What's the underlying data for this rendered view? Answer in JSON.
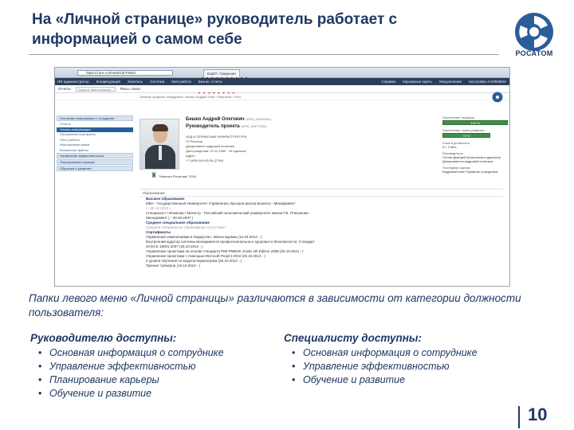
{
  "slide": {
    "title": "На «Личной странице» руководитель работает с информацией о самом себе",
    "logo_text": "РОСАТОМ",
    "page_number": "10",
    "caption": "Папки левого меню «Личной страницы» различаются в зависимости от категории должности пользователя:",
    "manager": {
      "heading": "Руководителю доступны:",
      "items": [
        "Основная информация о сотруднике",
        "Управление эффективностью",
        "Планирование карьеры",
        "Обучение и развитие"
      ]
    },
    "specialist": {
      "heading": "Специалисту доступны:",
      "items": [
        "Основная информация о сотруднике",
        "Управление эффективностью",
        "Обучение и развитие"
      ]
    }
  },
  "screenshot": {
    "address": "https://core-s-ehrw001/ETWeb/",
    "tab_label": "ЕЦЕП. Сведения",
    "nav_items": [
      "HR администратор",
      "Конфигурация",
      "Знаетесь",
      "Система",
      "Моя работа",
      "Бизнес отчеты"
    ],
    "nav_right": [
      "Справка",
      "Карьерные карты",
      "Уведомления",
      "Настройки ArchBelDite"
    ],
    "toolbar": [
      "Отчеты",
      "Поиск в Talent Network",
      "Расш. поиск"
    ],
    "breadcrumb": "Личный профиль сотрудника › Бешко Андрей Олег › Карточка › Учёт",
    "left_menu_header": "Основная информация о сотруднике",
    "left_menu_items": [
      "Отчеты",
      "Личная информация",
      "Обновление портфолио",
      "Опыт работы",
      "Иностранные языки",
      "Вложенные файлы"
    ],
    "left_menu_sections": [
      "Управление эффективностью",
      "Планирование карьеры",
      "Обучение и развитие"
    ],
    "person": {
      "name": "Бешко Андрей Олегович",
      "name_code": "(8700_00000344)",
      "position": "Руководитель проекта",
      "position_code": "(8700_00477305)",
      "info": [
        "АХД И СЕРВИСНЫЕ ИНФРАСТРУКТУРА",
        "ГК Росатом",
        "Департамент кадровой политики",
        "Дата рождения: 10.11.1985 · 29 годочков",
        "Адрес:",
        "+7 (495) 949-45-95 (2746)"
      ],
      "award": "\"Капитал Росатома\" 2015"
    },
    "right_col": {
      "profile_label": "Заполнение профиля",
      "profile_value": "100 %",
      "plan_label": "Заполнение плана развития",
      "plan_value": "73 %",
      "exp_label": "Стаж в должности",
      "exp_value": "6 г, 3 Мес",
      "manager_label": "Руководитель",
      "manager_value": "Гостев Дмитрий Анатольевич директор Департамента кадровой политики",
      "eval_label": "Последняя оценка",
      "eval_value": "Кадровый план Профиль сотрудника"
    },
    "education": {
      "tab": "Образование",
      "lines": [
        {
          "t": "Высшее образование",
          "c": "b"
        },
        {
          "t": "MBA - Государственный Университет Управления, Высшая Школа Бизнеса - Менеджмент",
          "c": "n"
        },
        {
          "t": "( - 30.12.2013 )",
          "c": "g"
        },
        {
          "t": "Специалист / Инженер / Магистр - Российский экономический университет имени Г.В. Плеханова -",
          "c": "n"
        },
        {
          "t": "Менеджмент ( - 30.06.2007 )",
          "c": "n"
        },
        {
          "t": "Среднее специальное образование",
          "c": "b"
        },
        {
          "t": "Среднее специальное образование отсутствует",
          "c": "g"
        },
        {
          "t": "Сертификаты",
          "c": "b"
        },
        {
          "t": "Управление изменениями и Лидерство. Эмпон Бурман (11.04.2014 - )",
          "c": "n"
        },
        {
          "t": "Внутренний аудитор системы менеджмента профессионального здоровья и безопасности. Стандарт",
          "c": "n"
        },
        {
          "t": "OHSAS 18001:2007 (26.10.2012 - )",
          "c": "n"
        },
        {
          "t": "Управление проектами на основе стандарта PMI PMBOK Guide 4th Edition 2008 (26.10.2012 - )",
          "c": "n"
        },
        {
          "t": "Управление проектами с помощью Microsoft Project 2010 (26.10.2012 - )",
          "c": "n"
        },
        {
          "t": "4 уровня обучения по модели Киркпатрика (26.10.2012 - )",
          "c": "n"
        },
        {
          "t": "Тренинг тренеров (15.10.2013 - )",
          "c": "n"
        }
      ]
    }
  }
}
